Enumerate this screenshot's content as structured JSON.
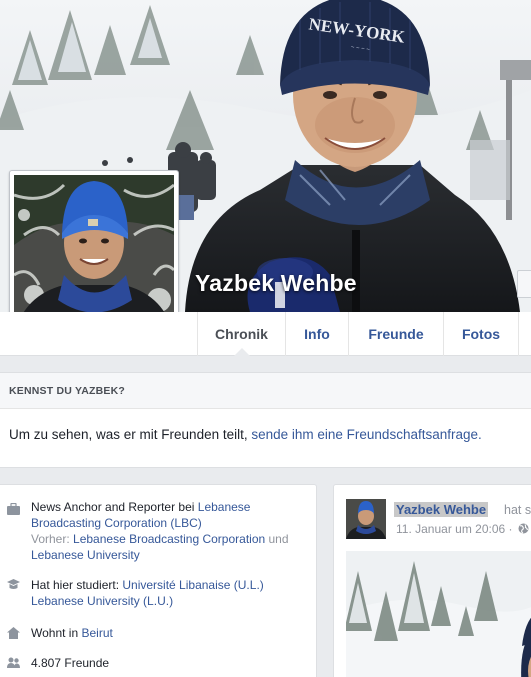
{
  "profile": {
    "name": "Yazbek Wehbe",
    "cap_text": "NEW-YORK"
  },
  "tabs": [
    {
      "label": "Chronik",
      "active": true
    },
    {
      "label": "Info",
      "active": false
    },
    {
      "label": "Freunde",
      "active": false
    },
    {
      "label": "Fotos",
      "active": false
    }
  ],
  "know_card": {
    "title": "KENNST DU YAZBEK?",
    "text": "Um zu sehen, was er mit Freunden teilt, ",
    "link": "sende ihm eine Freundschaftsanfrage."
  },
  "intro": {
    "work": {
      "prefix": "News Anchor and Reporter bei ",
      "employer": "Lebanese Broadcasting Corporation (LBC)",
      "previous_label": "Vorher: ",
      "previous_1": "Lebanese Broadcasting Corporation",
      "and": " und",
      "previous_2": "Lebanese University",
      "icon": "briefcase-icon"
    },
    "education": {
      "prefix": "Hat hier studiert: ",
      "school_1": "Université Libanaise (U.L.)",
      "school_2": "Lebanese University (L.U.)",
      "icon": "graduation-cap-icon"
    },
    "home": {
      "prefix": "Wohnt in ",
      "city": "Beirut",
      "icon": "house-icon"
    },
    "friends": {
      "count_text": "4.807 Freunde",
      "icon": "friends-icon"
    }
  },
  "post": {
    "author": "Yazbek Wehbe",
    "action": "hat s",
    "time": "11. Januar um 20:06 ·",
    "privacy_icon": "globe-icon"
  },
  "colors": {
    "link": "#365899",
    "background": "#e9ebee",
    "cap": "#1d2a4a",
    "scarf": "#2c3e66"
  }
}
